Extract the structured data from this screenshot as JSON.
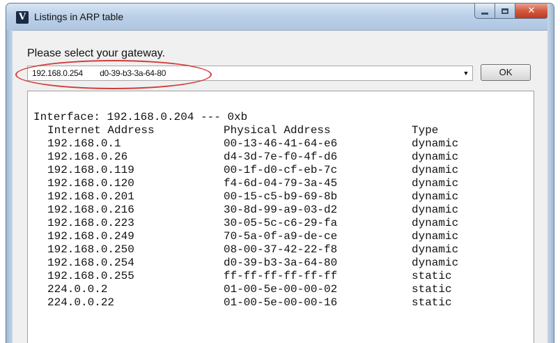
{
  "window": {
    "title": "Listings in ARP table",
    "icon_letter": "V"
  },
  "prompt": {
    "label": "Please select your gateway."
  },
  "gateway_select": {
    "selected_value": "192.168.0.254        d0-39-b3-3a-64-80"
  },
  "ok_button": {
    "label": "OK"
  },
  "arp_output": {
    "interface_line": "Interface: 192.168.0.204 --- 0xb",
    "headers": {
      "internet_address": "Internet Address",
      "physical_address": "Physical Address",
      "type": "Type"
    },
    "rows": [
      {
        "ip": "192.168.0.1",
        "mac": "00-13-46-41-64-e6",
        "type": "dynamic"
      },
      {
        "ip": "192.168.0.26",
        "mac": "d4-3d-7e-f0-4f-d6",
        "type": "dynamic"
      },
      {
        "ip": "192.168.0.119",
        "mac": "00-1f-d0-cf-eb-7c",
        "type": "dynamic"
      },
      {
        "ip": "192.168.0.120",
        "mac": "f4-6d-04-79-3a-45",
        "type": "dynamic"
      },
      {
        "ip": "192.168.0.201",
        "mac": "00-15-c5-b9-69-8b",
        "type": "dynamic"
      },
      {
        "ip": "192.168.0.216",
        "mac": "30-8d-99-a9-03-d2",
        "type": "dynamic"
      },
      {
        "ip": "192.168.0.223",
        "mac": "30-05-5c-c6-29-fa",
        "type": "dynamic"
      },
      {
        "ip": "192.168.0.249",
        "mac": "70-5a-0f-a9-de-ce",
        "type": "dynamic"
      },
      {
        "ip": "192.168.0.250",
        "mac": "08-00-37-42-22-f8",
        "type": "dynamic"
      },
      {
        "ip": "192.168.0.254",
        "mac": "d0-39-b3-3a-64-80",
        "type": "dynamic"
      },
      {
        "ip": "192.168.0.255",
        "mac": "ff-ff-ff-ff-ff-ff",
        "type": "static"
      },
      {
        "ip": "224.0.0.2",
        "mac": "01-00-5e-00-00-02",
        "type": "static"
      },
      {
        "ip": "224.0.0.22",
        "mac": "01-00-5e-00-00-16",
        "type": "static"
      }
    ]
  },
  "colors": {
    "highlight_ellipse": "#d23a3a",
    "close_button": "#c0391f"
  }
}
